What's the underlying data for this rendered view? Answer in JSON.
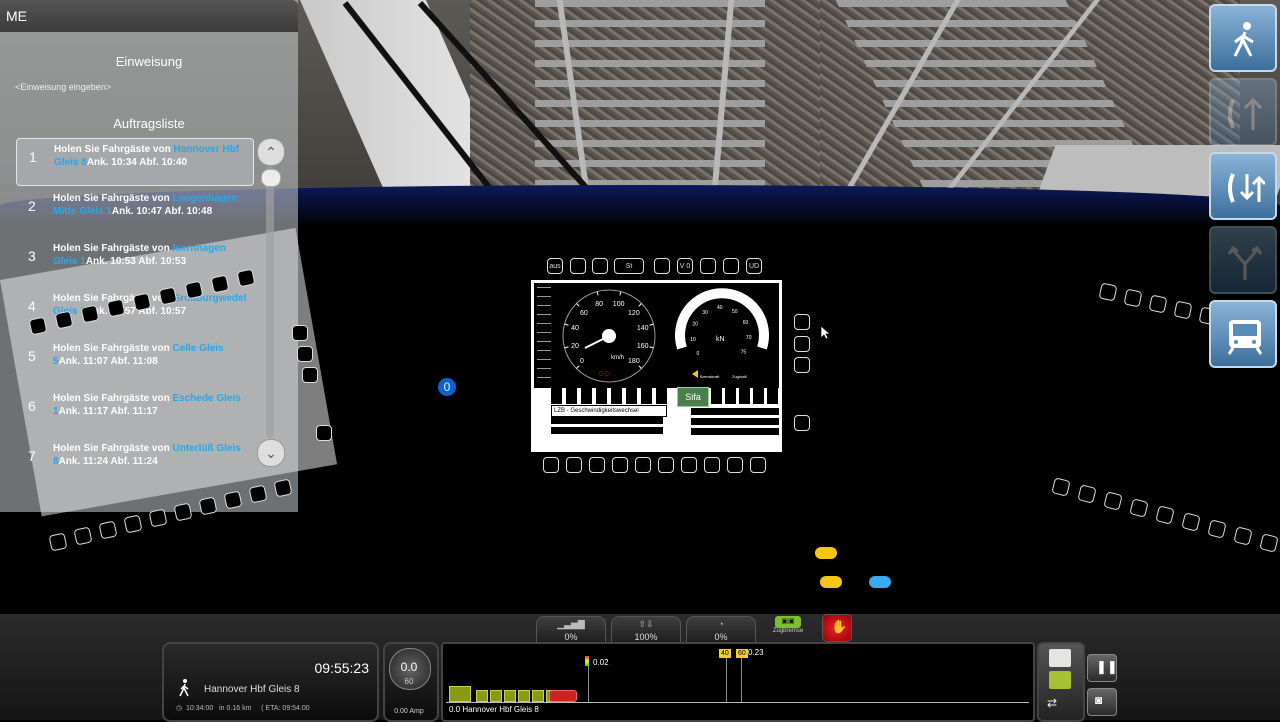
{
  "panel": {
    "titlebar": "ME",
    "instruction_title": "Einweisung",
    "instruction_placeholder": "<Einweisung eingeben>",
    "list_title": "Auftragsliste",
    "orders": [
      {
        "num": "1",
        "prefix": "Holen Sie Fahrgäste  von",
        "station": "Hannover Hbf Gleis 8",
        "suffix": "Ank. 10:34 Abf. 10:40"
      },
      {
        "num": "2",
        "prefix": "Holen Sie Fahrgäste  von",
        "station": "Langenhagen Mitte Gleis 1",
        "suffix": "Ank. 10:47 Abf. 10:48"
      },
      {
        "num": "3",
        "prefix": "Holen Sie Fahrgäste  von",
        "station": "Isernhagen Gleis 1",
        "suffix": "Ank. 10:53 Abf. 10:53"
      },
      {
        "num": "4",
        "prefix": "Holen Sie Fahrgäste  von",
        "station": "Großburgwedel Gleis 1",
        "suffix": "Ank. 10:57 Abf. 10:57"
      },
      {
        "num": "5",
        "prefix": "Holen Sie Fahrgäste  von",
        "station": "Celle Gleis 5",
        "suffix": "Ank. 11:07 Abf. 11:08"
      },
      {
        "num": "6",
        "prefix": "Holen Sie Fahrgäste  von",
        "station": "Eschede Gleis 1",
        "suffix": "Ank. 11:17 Abf. 11:17"
      },
      {
        "num": "7",
        "prefix": "Holen Sie Fahrgäste  von",
        "station": "Unterlüß Gleis 8",
        "suffix": "Ank. 11:24 Abf. 11:24"
      }
    ]
  },
  "dmi": {
    "speed_unit": "km/h",
    "speed_ticks": [
      "0",
      "20",
      "40",
      "60",
      "80",
      "100",
      "120",
      "140",
      "160",
      "180"
    ],
    "force_unit": "kN",
    "force_ticks": [
      "0",
      "10",
      "20",
      "30",
      "40",
      "50",
      "60",
      "70",
      "75"
    ],
    "sifa": "Sifa",
    "lzb": "LZB - Geschwindigkeitswechsel",
    "bremskraft": "Bremskraft",
    "zugkraft": "Zugkraft",
    "odometer": "0.0",
    "key_aus": "aus",
    "key_st": "St",
    "key_v0": "V 0",
    "key_ud": "UD"
  },
  "right_toolbar": [
    {
      "name": "walk-mode-button",
      "icon": "walking-person-icon",
      "dim": false
    },
    {
      "name": "direction-forward-button",
      "icon": "up-arrow-phone-icon",
      "dim": true
    },
    {
      "name": "phone-direction-button",
      "icon": "phone-arrows-icon",
      "dim": false
    },
    {
      "name": "switch-junction-button",
      "icon": "fork-arrows-icon",
      "dim": true
    },
    {
      "name": "train-view-button",
      "icon": "train-front-icon",
      "dim": false
    }
  ],
  "world": {
    "badge": "0"
  },
  "hud": {
    "stats": [
      {
        "label": "signal-strength-stat",
        "icon": "▁▃▅▇",
        "value": "0%"
      },
      {
        "label": "train-load-stat",
        "icon": "⇧⇩",
        "value": "100%"
      },
      {
        "label": "brake-stat",
        "icon": "◔",
        "value": "0%"
      }
    ],
    "train_brake_label": "Zugbremse",
    "time": "09:55:23",
    "destination": "Hannover Hbf Gleis 8",
    "eta_time": "10:34:00",
    "in_label": "in",
    "distance": "0.16 km",
    "eta_label": "( ETA:",
    "eta_value": "09:54:00",
    "speed": "0.0",
    "speed_limit": "60",
    "amperage": "0.00 Amp",
    "track_dest": "0.0 Hannover Hbf Gleis 8",
    "marker_002": "0.02",
    "marker_023": "0.23",
    "limit_40": "40",
    "limit_60": "60"
  },
  "colors": {
    "accent": "#2aa7e6",
    "dashboard_blue": "#0c1a5a",
    "sifa": "#4a7f4a",
    "marker_yellow": "#f3d12c",
    "lamp_yellow": "#f5c518",
    "lamp_blue": "#3ca8f0"
  }
}
